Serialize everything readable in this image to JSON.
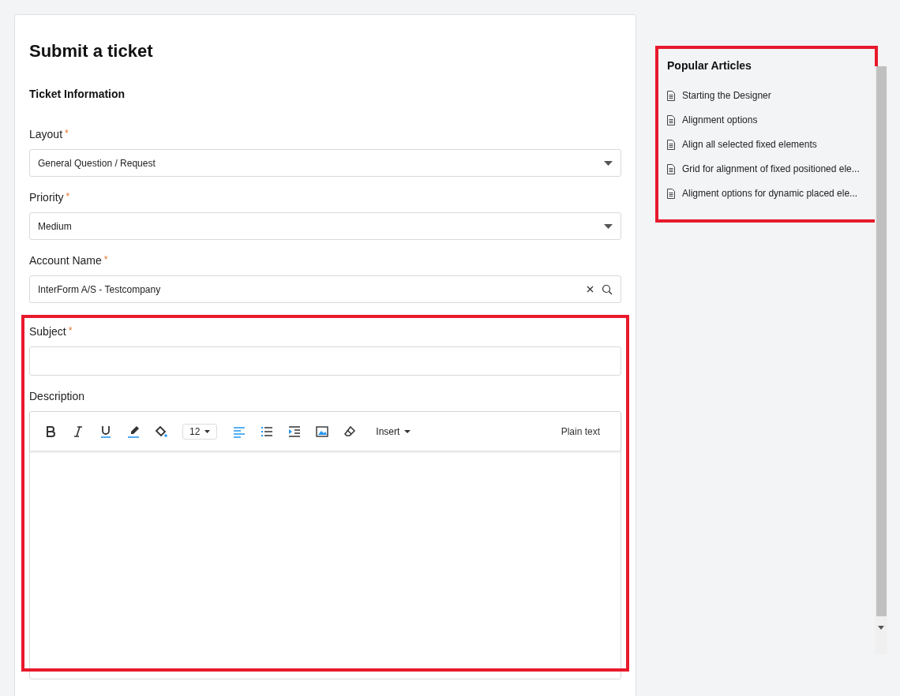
{
  "form": {
    "title": "Submit a ticket",
    "section": "Ticket Information",
    "fields": [
      {
        "kind": "select",
        "label": "Layout",
        "required_mark": "*",
        "value": "General Question / Request"
      },
      {
        "kind": "select",
        "label": "Priority",
        "required_mark": "*",
        "value": "Medium"
      },
      {
        "kind": "lookup",
        "label": "Account Name",
        "required_mark": "*",
        "value": "InterForm A/S - Testcompany"
      }
    ],
    "highlighted_group": {
      "highlighted": true,
      "fields": [
        {
          "kind": "text",
          "label": "Subject",
          "required_mark": "*"
        },
        {
          "kind": "editor",
          "label": "Description",
          "font_size": "12",
          "insert": "Insert",
          "mode": "Plain text"
        }
      ]
    }
  },
  "popular_articles": {
    "title": "Popular Articles",
    "highlighted": true,
    "items": [
      {
        "label": "Starting the Designer"
      },
      {
        "label": "Alignment options"
      },
      {
        "label": "Align all selected fixed elements"
      },
      {
        "label": "Grid for alignment of fixed positioned ele..."
      },
      {
        "label": "Aligment options for dynamic placed ele..."
      }
    ]
  }
}
